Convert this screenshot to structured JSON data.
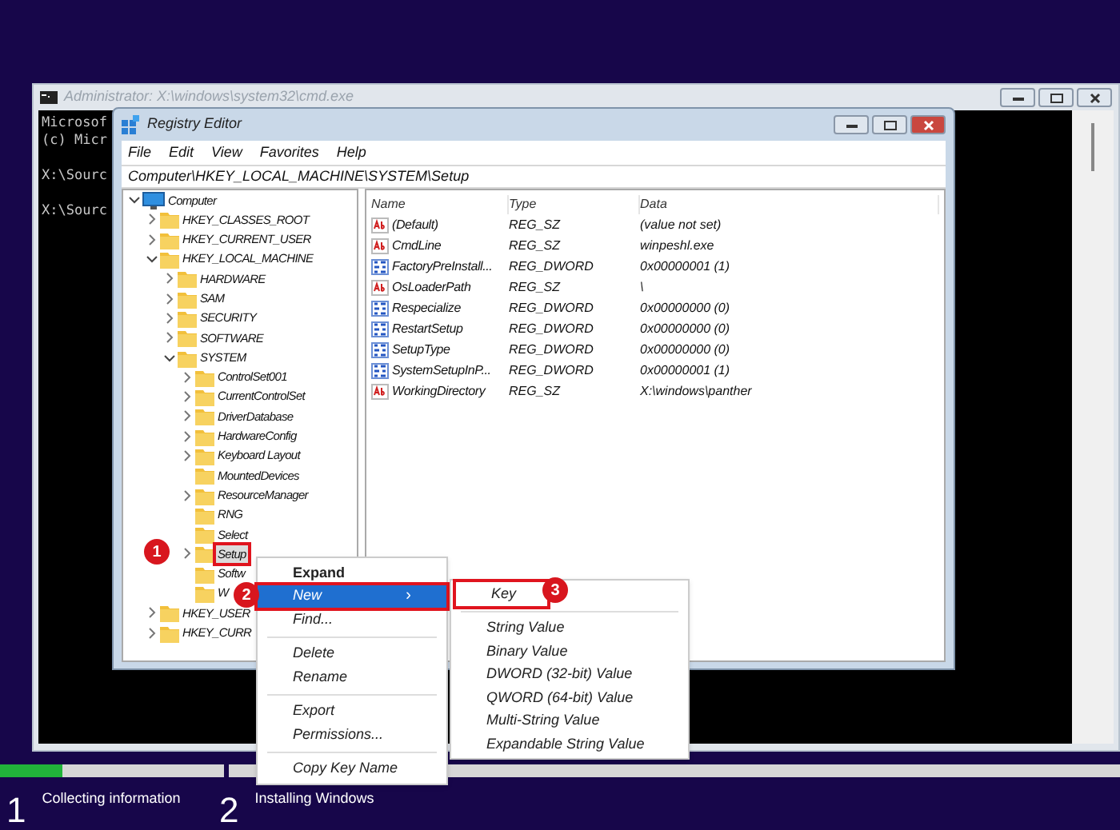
{
  "console": {
    "title": "Administrator: X:\\windows\\system32\\cmd.exe",
    "paragraphs": [
      [
        "Microsof",
        "(c) Micr"
      ],
      [
        "X:\\Sourc"
      ],
      [
        "X:\\Sourc"
      ]
    ]
  },
  "regedit": {
    "title": "Registry Editor",
    "menu": [
      "File",
      "Edit",
      "View",
      "Favorites",
      "Help"
    ],
    "address": "Computer\\HKEY_LOCAL_MACHINE\\SYSTEM\\Setup",
    "tree": [
      {
        "label": "Computer",
        "kind": "computer",
        "expanded": true,
        "children": [
          {
            "label": "HKEY_CLASSES_ROOT",
            "expanded": false
          },
          {
            "label": "HKEY_CURRENT_USER",
            "expanded": false
          },
          {
            "label": "HKEY_LOCAL_MACHINE",
            "expanded": true,
            "children": [
              {
                "label": "HARDWARE",
                "expanded": false
              },
              {
                "label": "SAM",
                "expanded": false
              },
              {
                "label": "SECURITY",
                "expanded": false
              },
              {
                "label": "SOFTWARE",
                "expanded": false
              },
              {
                "label": "SYSTEM",
                "expanded": true,
                "children": [
                  {
                    "label": "ControlSet001",
                    "expanded": false
                  },
                  {
                    "label": "CurrentControlSet",
                    "expanded": false
                  },
                  {
                    "label": "DriverDatabase",
                    "expanded": false
                  },
                  {
                    "label": "HardwareConfig",
                    "expanded": false
                  },
                  {
                    "label": "Keyboard Layout",
                    "expanded": false
                  },
                  {
                    "label": "MountedDevices"
                  },
                  {
                    "label": "ResourceManager",
                    "expanded": false
                  },
                  {
                    "label": "RNG"
                  },
                  {
                    "label": "Select"
                  },
                  {
                    "label": "Setup",
                    "expanded": false,
                    "highlighted": true
                  },
                  {
                    "label": "Softw"
                  },
                  {
                    "label": "W"
                  }
                ]
              }
            ]
          },
          {
            "label": "HKEY_USER",
            "expanded": false
          },
          {
            "label": "HKEY_CURR",
            "expanded": false
          }
        ]
      }
    ],
    "columns": [
      "Name",
      "Type",
      "Data"
    ],
    "values": [
      {
        "name": "(Default)",
        "kind": "string",
        "type": "REG_SZ",
        "data": "(value not set)"
      },
      {
        "name": "CmdLine",
        "kind": "string",
        "type": "REG_SZ",
        "data": "winpeshl.exe"
      },
      {
        "name": "FactoryPreInstall...",
        "kind": "binary",
        "type": "REG_DWORD",
        "data": "0x00000001 (1)"
      },
      {
        "name": "OsLoaderPath",
        "kind": "string",
        "type": "REG_SZ",
        "data": "\\"
      },
      {
        "name": "Respecialize",
        "kind": "binary",
        "type": "REG_DWORD",
        "data": "0x00000000 (0)"
      },
      {
        "name": "RestartSetup",
        "kind": "binary",
        "type": "REG_DWORD",
        "data": "0x00000000 (0)"
      },
      {
        "name": "SetupType",
        "kind": "binary",
        "type": "REG_DWORD",
        "data": "0x00000000 (0)"
      },
      {
        "name": "SystemSetupInP...",
        "kind": "binary",
        "type": "REG_DWORD",
        "data": "0x00000001 (1)"
      },
      {
        "name": "WorkingDirectory",
        "kind": "string",
        "type": "REG_SZ",
        "data": "X:\\windows\\panther"
      }
    ]
  },
  "context_menu": {
    "items": [
      {
        "label": "Expand",
        "kind": "default",
        "selected": false
      },
      {
        "label": "New",
        "kind": "submenu",
        "selected": true,
        "highlighted": true,
        "arrow": "›"
      },
      {
        "label": "Find...",
        "kind": "item",
        "selected": false
      },
      {
        "kind": "separator"
      },
      {
        "label": "Delete",
        "kind": "item",
        "selected": false
      },
      {
        "label": "Rename",
        "kind": "item",
        "selected": false
      },
      {
        "kind": "separator"
      },
      {
        "label": "Export",
        "kind": "item",
        "selected": false
      },
      {
        "label": "Permissions...",
        "kind": "item",
        "selected": false
      },
      {
        "kind": "separator"
      },
      {
        "label": "Copy Key Name",
        "kind": "item",
        "selected": false
      }
    ]
  },
  "submenu": {
    "items": [
      {
        "label": "Key",
        "kind": "item",
        "highlighted": true
      },
      {
        "kind": "separator"
      },
      {
        "label": "String Value",
        "kind": "item"
      },
      {
        "label": "Binary Value",
        "kind": "item"
      },
      {
        "label": "DWORD (32-bit) Value",
        "kind": "item"
      },
      {
        "label": "QWORD (64-bit) Value",
        "kind": "item"
      },
      {
        "label": "Multi-String Value",
        "kind": "item"
      },
      {
        "label": "Expandable String Value",
        "kind": "item"
      }
    ]
  },
  "annotations": [
    "1",
    "2",
    "3"
  ],
  "setup_progress": {
    "segments": [
      {
        "level": 0.28
      },
      {
        "level": 0
      }
    ],
    "steps": [
      {
        "number": "1",
        "label": "Collecting information"
      },
      {
        "number": "2",
        "label": "Installing Windows"
      }
    ]
  }
}
